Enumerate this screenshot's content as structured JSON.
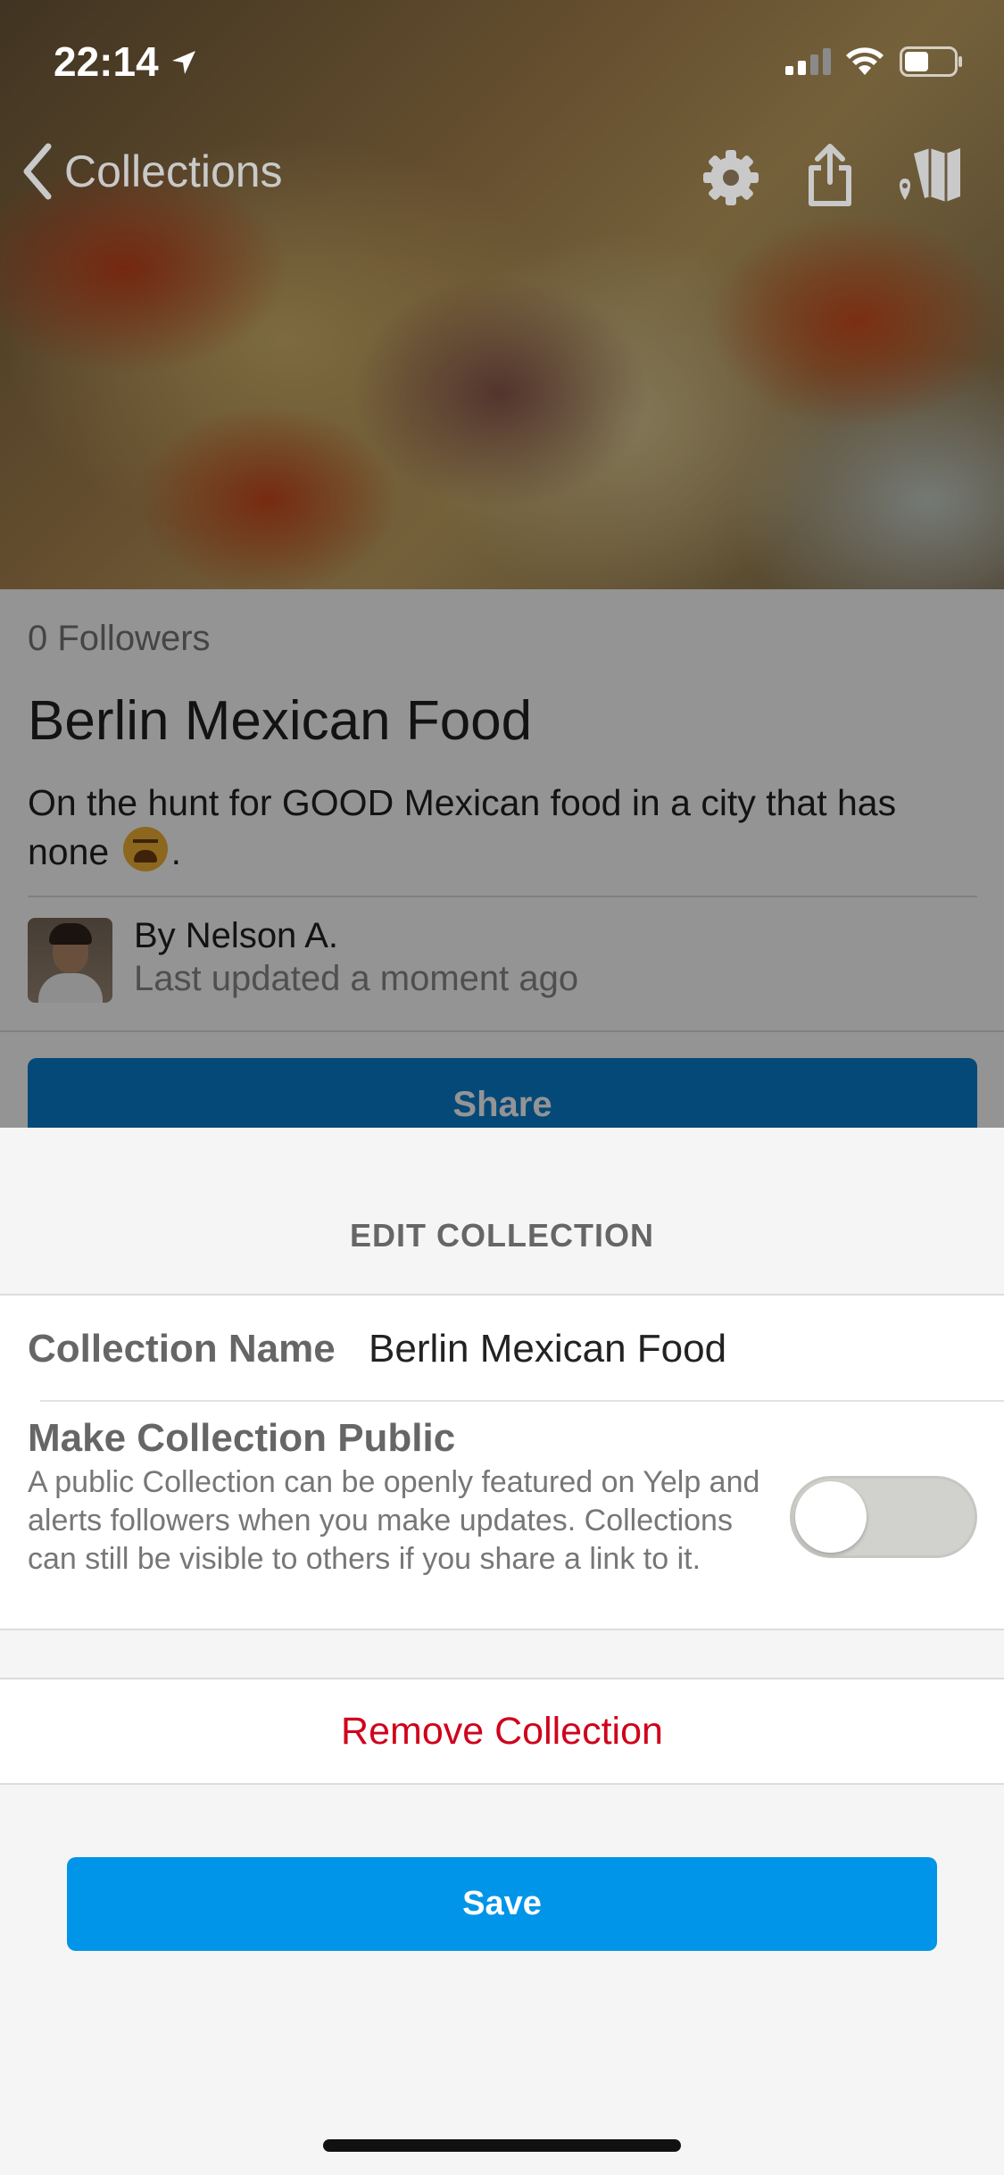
{
  "status_bar": {
    "time": "22:14",
    "icons": [
      "location-arrow-icon",
      "signal-icon",
      "wifi-icon",
      "battery-icon"
    ]
  },
  "nav": {
    "back_label": "Collections",
    "icons": [
      "chevron-left-icon",
      "gear-icon",
      "share-icon",
      "map-icon"
    ]
  },
  "collection": {
    "followers": "0 Followers",
    "title": "Berlin Mexican Food",
    "description": "On the hunt for GOOD Mexican food in a city that has none",
    "description_end": ".",
    "author": "By Nelson A.",
    "updated": "Last updated a moment ago",
    "share_label": "Share"
  },
  "sheet": {
    "title": "EDIT COLLECTION",
    "name_label": "Collection Name",
    "name_value": "Berlin Mexican Food",
    "public_label": "Make Collection Public",
    "public_description": "A public Collection can be openly featured on Yelp and alerts followers when you make updates. Collections can still be visible to others if you share a link to it.",
    "public_enabled": false,
    "remove_label": "Remove Collection",
    "save_label": "Save"
  },
  "colors": {
    "accent_blue": "#0095e8",
    "destructive_red": "#d0021b",
    "toggle_off": "#d1d2cd"
  }
}
